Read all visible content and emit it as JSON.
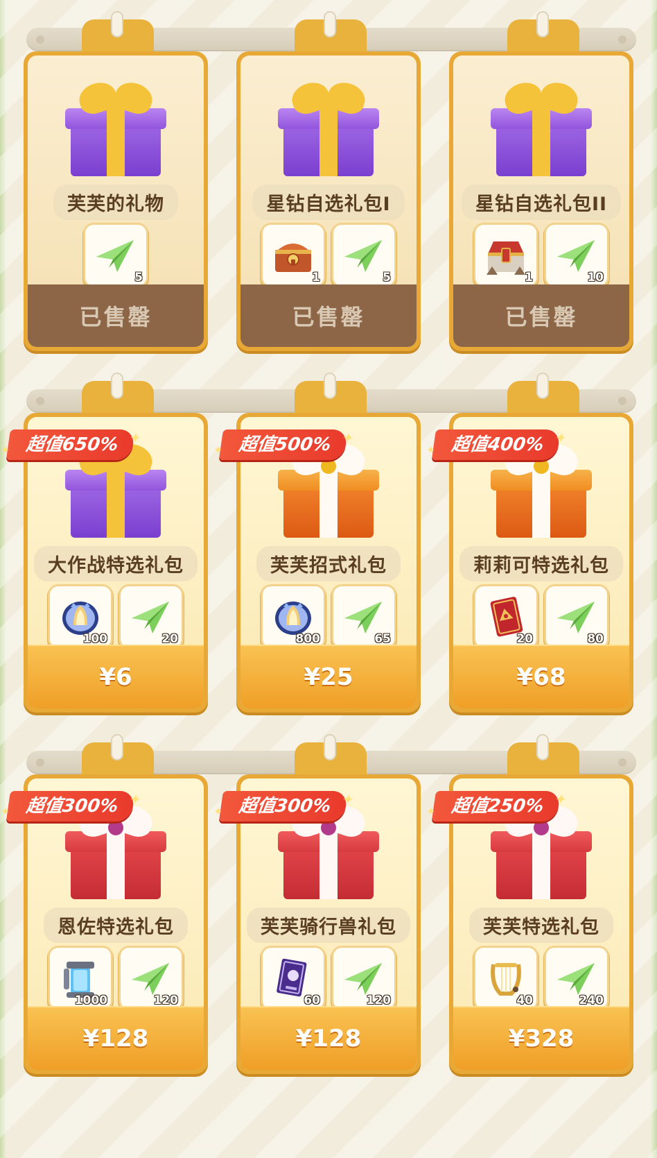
{
  "sections": [
    {
      "cards": [
        {
          "name": "芙芙的礼物",
          "gift": "purple",
          "ribbon": "",
          "footer": "已售罄",
          "state": "sold",
          "items": [
            {
              "icon": "paper-plane",
              "qty": "5"
            }
          ]
        },
        {
          "name": "星钻自选礼包I",
          "gift": "purple",
          "ribbon": "",
          "footer": "已售罄",
          "state": "sold",
          "items": [
            {
              "icon": "treasure-chest",
              "qty": "1"
            },
            {
              "icon": "paper-plane",
              "qty": "5"
            }
          ]
        },
        {
          "name": "星钻自选礼包II",
          "gift": "purple",
          "ribbon": "",
          "footer": "已售罄",
          "state": "sold",
          "items": [
            {
              "icon": "ornate-chest",
              "qty": "1"
            },
            {
              "icon": "paper-plane",
              "qty": "10"
            }
          ]
        }
      ]
    },
    {
      "cards": [
        {
          "name": "大作战特选礼包",
          "gift": "purple",
          "ribbon": "超值650%",
          "footer": "¥6",
          "state": "buy",
          "items": [
            {
              "icon": "crystal-orb",
              "qty": "100"
            },
            {
              "icon": "paper-plane",
              "qty": "20"
            }
          ]
        },
        {
          "name": "芙芙招式礼包",
          "gift": "orange",
          "ribbon": "超值500%",
          "footer": "¥25",
          "state": "buy",
          "items": [
            {
              "icon": "crystal-orb",
              "qty": "800"
            },
            {
              "icon": "paper-plane",
              "qty": "65"
            }
          ]
        },
        {
          "name": "莉莉可特选礼包",
          "gift": "orange",
          "ribbon": "超值400%",
          "footer": "¥68",
          "state": "buy",
          "items": [
            {
              "icon": "red-card",
              "qty": "20"
            },
            {
              "icon": "paper-plane",
              "qty": "80"
            }
          ]
        }
      ]
    },
    {
      "cards": [
        {
          "name": "恩佐特选礼包",
          "gift": "red",
          "ribbon": "超值300%",
          "footer": "¥128",
          "state": "buy",
          "items": [
            {
              "icon": "energy-capsule",
              "qty": "1000"
            },
            {
              "icon": "paper-plane",
              "qty": "120"
            }
          ]
        },
        {
          "name": "芙芙骑行兽礼包",
          "gift": "red",
          "ribbon": "超值300%",
          "footer": "¥128",
          "state": "buy",
          "items": [
            {
              "icon": "purple-ticket",
              "qty": "60"
            },
            {
              "icon": "paper-plane",
              "qty": "120"
            }
          ]
        },
        {
          "name": "芙芙特选礼包",
          "gift": "red",
          "ribbon": "超值250%",
          "footer": "¥328",
          "state": "buy",
          "items": [
            {
              "icon": "golden-lyre",
              "qty": "40"
            },
            {
              "icon": "paper-plane",
              "qty": "240"
            }
          ]
        }
      ]
    }
  ]
}
